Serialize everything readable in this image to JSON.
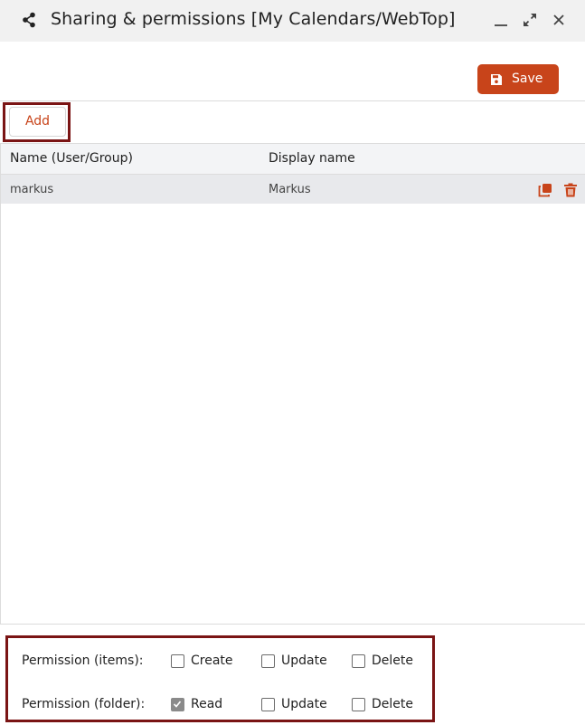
{
  "window": {
    "title": "Sharing & permissions [My Calendars/WebTop]",
    "accent_color": "#c8441a",
    "highlight_color": "#7a1414"
  },
  "toolbar": {
    "save_label": "Save",
    "add_label": "Add"
  },
  "grid": {
    "columns": [
      "Name (User/Group)",
      "Display name"
    ],
    "rows": [
      {
        "name": "markus",
        "display_name": "Markus",
        "actions": [
          "copy-icon",
          "trash-icon"
        ]
      }
    ]
  },
  "permissions": {
    "items": {
      "label": "Permission (items):",
      "options": [
        {
          "label": "Create",
          "checked": false
        },
        {
          "label": "Update",
          "checked": false
        },
        {
          "label": "Delete",
          "checked": false
        }
      ]
    },
    "folder": {
      "label": "Permission (folder):",
      "options": [
        {
          "label": "Read",
          "checked": true
        },
        {
          "label": "Update",
          "checked": false
        },
        {
          "label": "Delete",
          "checked": false
        }
      ]
    }
  }
}
